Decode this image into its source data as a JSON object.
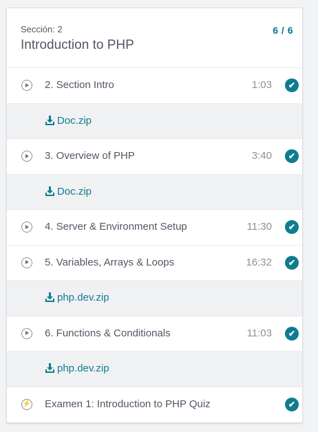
{
  "section": {
    "label": "Sección: 2",
    "title": "Introduction to PHP",
    "progress": "6 / 6"
  },
  "items": [
    {
      "type": "lecture",
      "title": "2.  Section Intro",
      "duration": "1:03",
      "completed": true,
      "resource": "Doc.zip"
    },
    {
      "type": "lecture",
      "title": "3.  Overview of PHP",
      "duration": "3:40",
      "completed": true,
      "resource": "Doc.zip"
    },
    {
      "type": "lecture",
      "title": "4.  Server & Environment Setup",
      "duration": "11:30",
      "completed": true
    },
    {
      "type": "lecture",
      "title": "5.  Variables, Arrays & Loops",
      "duration": "16:32",
      "completed": true,
      "resource": "php.dev.zip"
    },
    {
      "type": "lecture",
      "title": "6.  Functions & Conditionals",
      "duration": "11:03",
      "completed": true,
      "resource": "php.dev.zip"
    },
    {
      "type": "quiz",
      "title": "Examen 1:  Introduction to PHP Quiz",
      "duration": "",
      "completed": true
    }
  ],
  "icons": {
    "play": "play-circle-icon",
    "quiz": "bolt-icon",
    "complete": "check-circle-icon",
    "download": "download-icon"
  },
  "colors": {
    "accent": "#0f7c90",
    "text": "#505763",
    "muted": "#8a9099",
    "resource_bg": "#f0f1f3"
  }
}
